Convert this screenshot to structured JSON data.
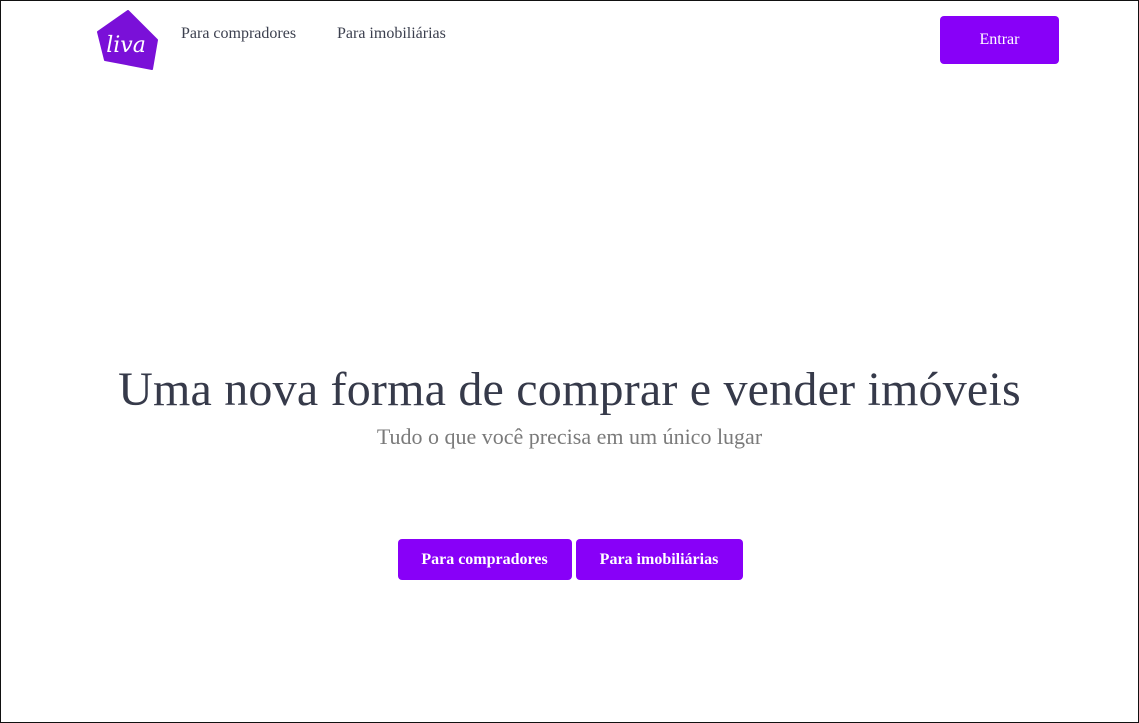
{
  "header": {
    "logo_text": "liva",
    "nav": [
      {
        "label": "Para compradores"
      },
      {
        "label": "Para imobiliárias"
      }
    ],
    "login_label": "Entrar"
  },
  "hero": {
    "title": "Uma nova forma de comprar e vender imóveis",
    "subtitle": "Tudo o que você precisa em um único lugar",
    "buttons": [
      {
        "label": "Para compradores"
      },
      {
        "label": "Para imobiliárias"
      }
    ]
  },
  "colors": {
    "brand_purple": "#8800f8",
    "logo_purple": "#7a10d8",
    "title_text": "#363a4a",
    "subtitle_text": "#7a7a7a",
    "nav_text": "#3b3f4e"
  },
  "icons": {
    "logo": "house-logo-icon"
  }
}
